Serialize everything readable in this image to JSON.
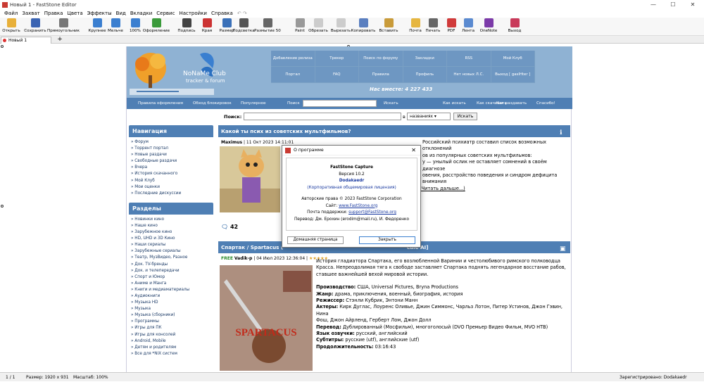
{
  "window": {
    "title": "Новый 1 - FastStone Editor"
  },
  "menu": [
    "Файл",
    "Захват",
    "Правка",
    "Цвета",
    "Эффекты",
    "Вид",
    "Вкладки",
    "Сервис",
    "Настройки",
    "Справка"
  ],
  "toolbar": [
    {
      "label": "Открыть",
      "icon": "folder-icon",
      "color": "#e8b03a"
    },
    {
      "label": "Сохранить",
      "icon": "save-icon",
      "color": "#3b64b3"
    },
    {
      "label": "Прямоугольник",
      "icon": "rectangle-select-icon",
      "color": "#777777"
    },
    {
      "label": "Крупнее",
      "icon": "zoom-in-icon",
      "color": "#3b7fd0"
    },
    {
      "label": "Мельче",
      "icon": "zoom-out-icon",
      "color": "#3b7fd0"
    },
    {
      "label": "100%",
      "icon": "zoom-100-icon",
      "color": "#3b7fd0"
    },
    {
      "label": "Оформление",
      "icon": "draw-icon",
      "color": "#3a9a3a"
    },
    {
      "label": "Подпись",
      "icon": "caption-icon",
      "color": "#444444"
    },
    {
      "label": "Края",
      "icon": "edge-icon",
      "color": "#cc3333"
    },
    {
      "label": "Размер",
      "icon": "resize-icon",
      "color": "#3a70b8"
    },
    {
      "label": "Подсветка",
      "icon": "spotlight-icon",
      "color": "#555555"
    },
    {
      "label": "Размытие 50",
      "icon": "blur-icon",
      "color": "#666666"
    },
    {
      "label": "Paint",
      "icon": "paint-icon",
      "color": "#999999"
    },
    {
      "label": "Обрезать",
      "icon": "crop-icon",
      "color": "#cccccc"
    },
    {
      "label": "Вырезать",
      "icon": "cut-icon",
      "color": "#cccccc"
    },
    {
      "label": "Копировать",
      "icon": "copy-icon",
      "color": "#5a7fc0"
    },
    {
      "label": "Вставить",
      "icon": "paste-icon",
      "color": "#c99b3a"
    },
    {
      "label": "Почта",
      "icon": "mail-icon",
      "color": "#e6b640"
    },
    {
      "label": "Печать",
      "icon": "print-icon",
      "color": "#666666"
    },
    {
      "label": "PDF",
      "icon": "pdf-icon",
      "color": "#d03a3a"
    },
    {
      "label": "Лента",
      "icon": "filmstrip-icon",
      "color": "#5a8ad0"
    },
    {
      "label": "OneNote",
      "icon": "onenote-icon",
      "color": "#7b3aa8"
    },
    {
      "label": "Выход",
      "icon": "power-icon",
      "color": "#c93a5a"
    }
  ],
  "tab": {
    "label": "Новый 1",
    "plus": "+"
  },
  "site": {
    "brand": "NoNaMe Club",
    "tagline": "tracker & forum",
    "nav": [
      "Добавление релиза",
      "Трекер",
      "Поиск по форуму",
      "Закладки",
      "RSS",
      "Мой Клуб",
      "Портал",
      "FAQ",
      "Правила",
      "Профиль",
      "Нет новых Л.С.",
      "Выход [ gaslHter ]"
    ],
    "online": "Нас вместе: 4 227 433",
    "subnav": [
      "Правила оформления",
      "Обход блокировок",
      "Популярное",
      "Поиск",
      "Искать",
      "Как искать",
      "Как скачивать",
      "Как раздавать",
      "Спасибо!"
    ],
    "search": {
      "label": "Поиск:",
      "in": "в",
      "select": "названиях",
      "button": "Искать"
    },
    "nav_head": "Навигация",
    "nav_items": [
      "Форум",
      "Торрент портал",
      "Новые раздачи",
      "Свободные раздачи",
      "Вчера",
      "История скачанного",
      "Мой Клуб",
      "Мои оценки",
      "Последние дискуссии"
    ],
    "sections_head": "Разделы",
    "sections": [
      "Новинки кино",
      "Наше кино",
      "Зарубежное кино",
      "HD, UHD и 3D Кино",
      "Наши сериалы",
      "Зарубежные сериалы",
      "Театр, МузВидео, Разное",
      "Док. TV-бренды",
      "Док. и телепередачи",
      "Спорт и Юмор",
      "Аниме и Манга",
      "Книги и медиаматериалы",
      "Аудиокниги",
      "Музыка HD",
      "Музыка",
      "Музыка (сборники)",
      "Программы",
      "Игры для ПК",
      "Игры для консолей",
      "Android, Mobile",
      "Детям и родителям",
      "Все для *NIX систем"
    ],
    "post1": {
      "title": "Какой ты псих из советских мультфильмов?",
      "author": "Maximus",
      "date": "11 Окт 2023 14:11:01",
      "lines": [
        "Российский психиатр составил список возможных отклонений",
        "ов из популярных советских мультфильмов:",
        "у — унылый ослик не оставляет сомнений в своём диагнозе",
        "овения, расстройство поведения и синдром дефицита внимания"
      ],
      "readmore": "(Читать дальше...)",
      "comments": "42"
    },
    "post2": {
      "title": "Спартак / Spartacus (",
      "title_end": "cale AI]",
      "free": "FREE",
      "author": "Vadik-p",
      "date": "04 Июл 2023 12:36:04",
      "stars": "★★★★★",
      "desc": [
        "История гладиатора Спартака, его возлюбленной Варинии и честолюбивого римского полководца",
        "Красса. Непреодолимая тяга к свободе заставляет Спартака поднять легендарное восстание рабов,",
        "ставшее важнейшей вехой мировой истории."
      ],
      "fields": [
        {
          "k": "Производство:",
          "v": " США, Universal Pictures, Bryna Productions"
        },
        {
          "k": "Жанр:",
          "v": " драма, приключения, военный, биография, история"
        },
        {
          "k": "Режиссер:",
          "v": " Стэнли Кубрик, Энтони Манн"
        },
        {
          "k": "Актеры:",
          "v": " Кирк Дуглас, Лоуренс Оливье, Джин Симмонс, Чарльз Лотон, Питер Устинов, Джон Гэвин, Нина"
        },
        {
          "k": "",
          "v": "Фош, Джон Айрленд, Герберт Лом, Джон Долл"
        },
        {
          "k": "Перевод:",
          "v": " Дублированный (Мосфильм), многоголосый (DVO Премьер Видео Фильм, MVO HTB)"
        },
        {
          "k": "Язык озвучки:",
          "v": " русский, английский"
        },
        {
          "k": "Субтитры:",
          "v": " русские (utf), английские (utf)"
        },
        {
          "k": "Продолжительность:",
          "v": " 03:16:43"
        }
      ],
      "poster_title": "SPARTACUS"
    }
  },
  "dialog": {
    "title": "О программе",
    "product": "FastStone Capture",
    "version": "Версия 10.2",
    "user": "Dodakaedr",
    "license": "(Корпоративная общемировая лицензия)",
    "copyright": "Авторские права © 2023 FastStone Corporation",
    "site_label": "Сайт:",
    "site": "www.FastStone.org",
    "support_label": "Почта поддержки:",
    "support": "support@FastStone.org",
    "translation": "Перевод: Дм. Ерохин (erodim@mail.ru), И. Федоренко",
    "home_button": "Домашняя страница",
    "close_button": "Закрыть"
  },
  "status": {
    "page": "1 / 1",
    "size": "Размер: 1920 x 931",
    "zoom": "Масштаб: 100%",
    "registered": "Зарегистрировано: Dodakaedr"
  }
}
